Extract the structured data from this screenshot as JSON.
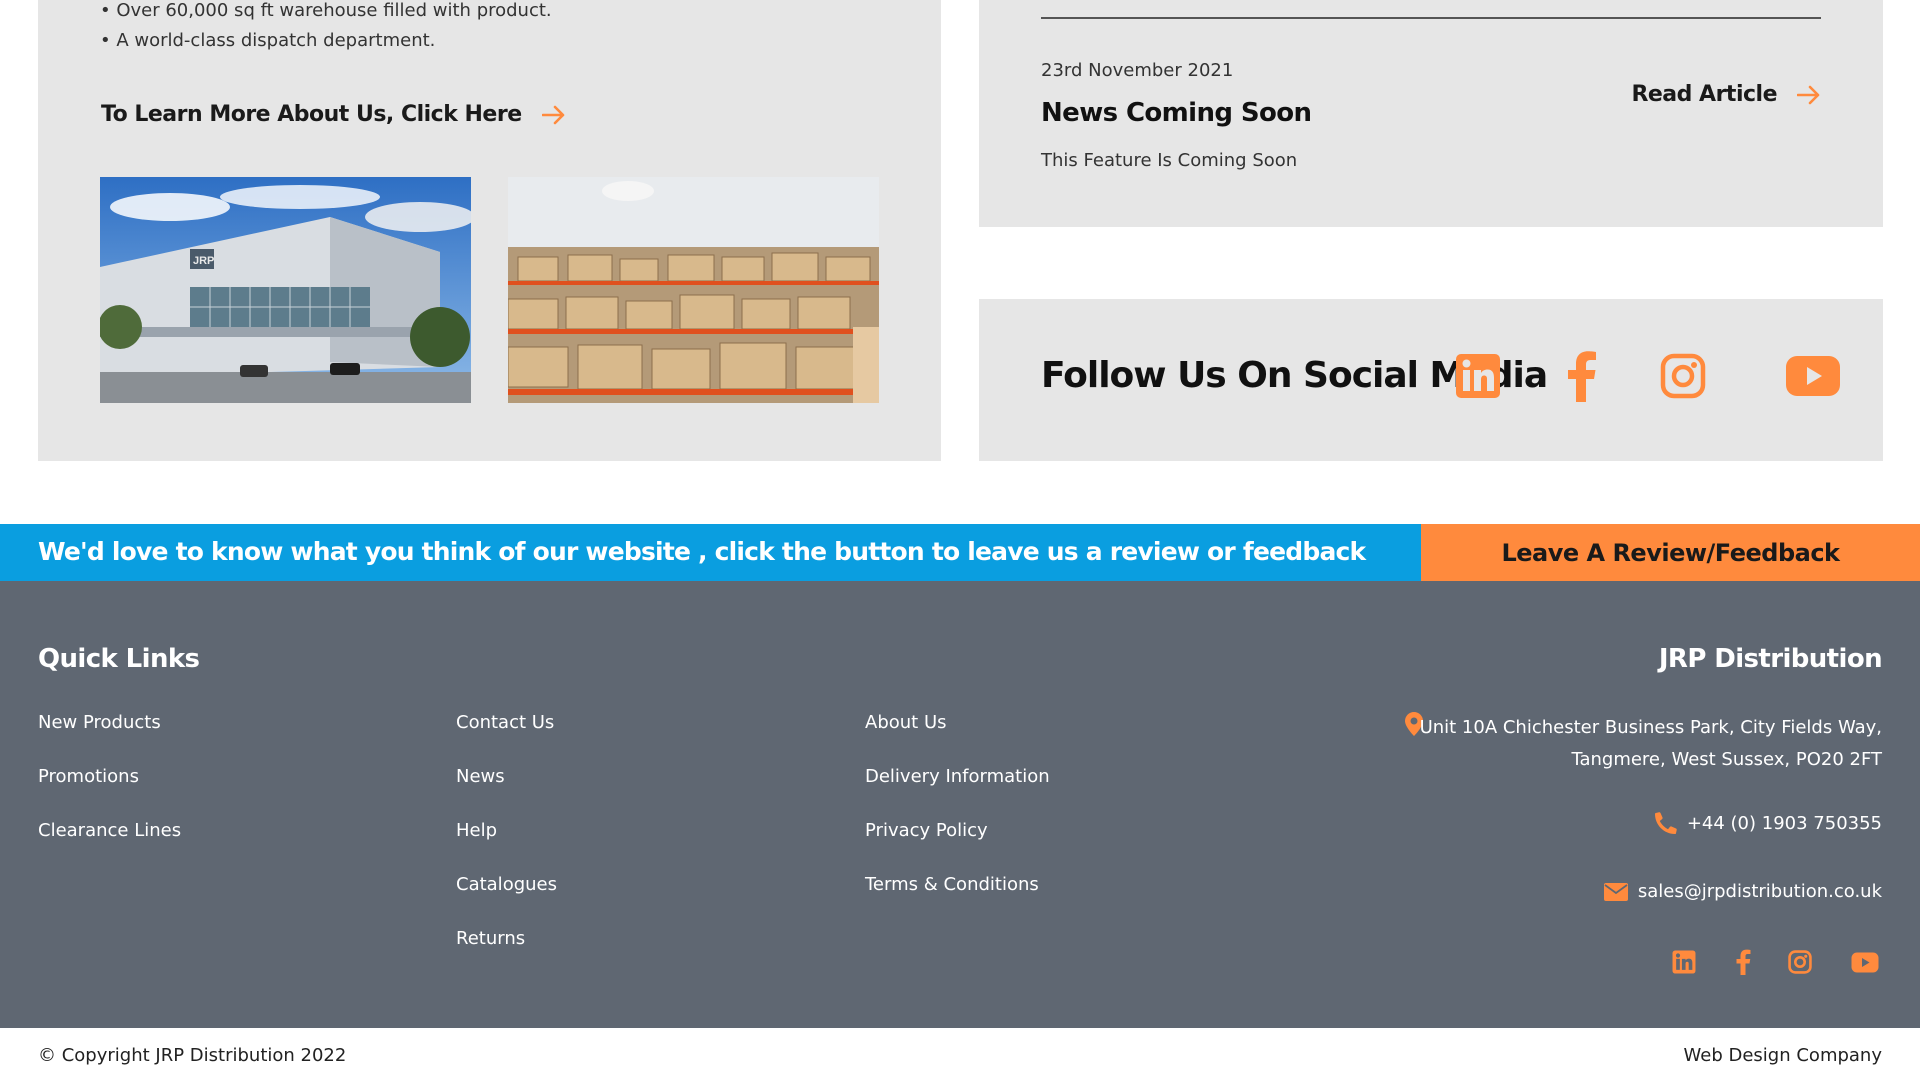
{
  "about": {
    "bullets": [
      "• Over 60,000 sq ft warehouse filled with product.",
      "• A world-class dispatch department."
    ],
    "learn_more_label": "To Learn More About Us, Click Here",
    "building_sign": "JRP"
  },
  "news": {
    "date": "23rd November 2021",
    "title": "News Coming Soon",
    "excerpt": "This Feature Is Coming Soon",
    "read_label": "Read Article"
  },
  "social": {
    "heading": "Follow Us On Social Media",
    "icons": [
      "linkedin-icon",
      "facebook-icon",
      "instagram-icon",
      "youtube-icon"
    ]
  },
  "review": {
    "text": "We'd love to know what you think of our website , click the button to leave us a review or feedback",
    "button_label": "Leave A Review/Feedback"
  },
  "footer": {
    "quick_links_heading": "Quick Links",
    "columns": [
      [
        "New Products",
        "Promotions",
        "Clearance Lines"
      ],
      [
        "Contact Us",
        "News",
        "Help",
        "Catalogues",
        "Returns"
      ],
      [
        "About Us",
        "Delivery Information",
        "Privacy Policy",
        "Terms & Conditions"
      ]
    ],
    "company_heading": "JRP Distribution",
    "address_line1": "Unit 10A Chichester Business Park, City Fields Way,",
    "address_line2": "Tangmere, West Sussex, PO20 2FT",
    "phone": "+44 (0) 1903 750355",
    "email": "sales@jrpdistribution.co.uk"
  },
  "bottom": {
    "copyright": "© Copyright JRP Distribution 2022",
    "web_design": "Web Design Company"
  },
  "colors": {
    "accent": "#ff8a3d",
    "blue": "#0a9ee0",
    "footer_bg": "#5f6772",
    "card_bg": "#e6e6e6"
  }
}
